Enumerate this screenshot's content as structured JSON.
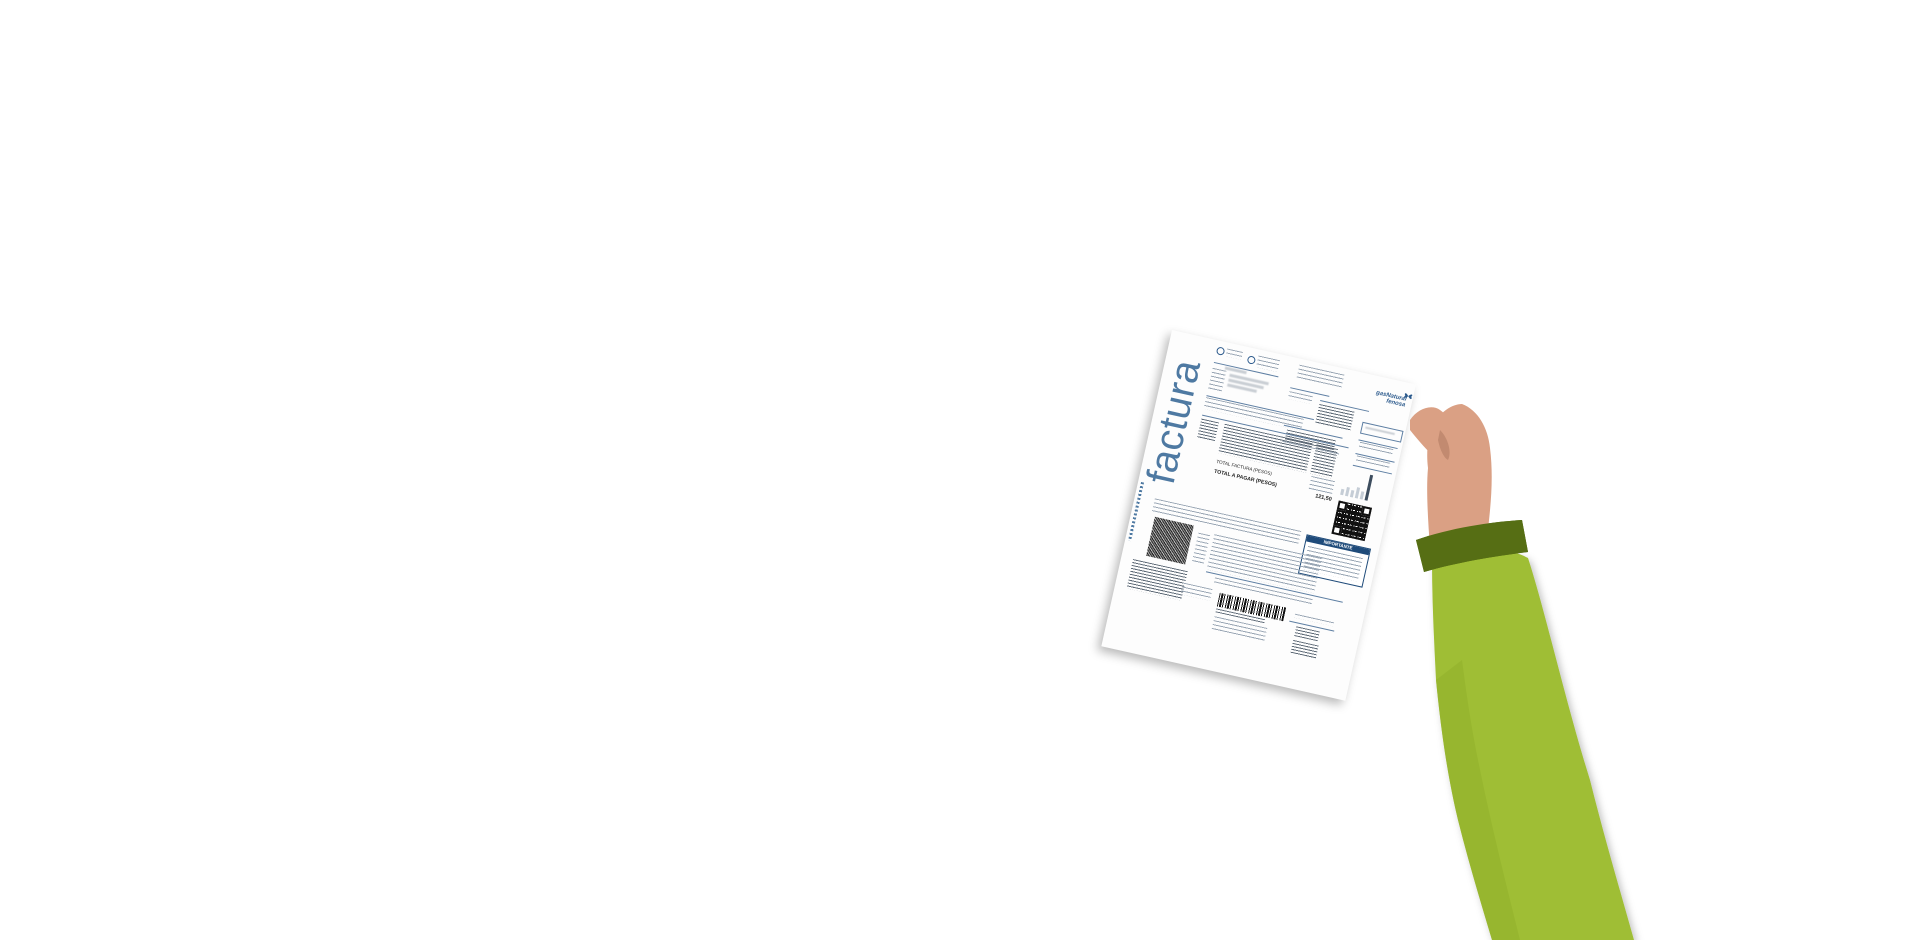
{
  "invoice": {
    "title": "factura",
    "total_factura_label": "TOTAL FACTURA (PESOS)",
    "total_pagar_label": "TOTAL A PAGAR (PESOS)",
    "total_amount": "121,50",
    "importante_label": "IMPORTANTE",
    "brand_line1": "gasNatural",
    "brand_line2": "fenosa",
    "brand_icon": "butterfly-icon",
    "paper_color": "#fdfdfd",
    "accent_color": "#4e79a2"
  },
  "scene": {
    "background_color": "#ffffff",
    "sleeve_color": "#9fbe34",
    "cuff_color": "#566e14",
    "skin_color": "#daa084"
  }
}
